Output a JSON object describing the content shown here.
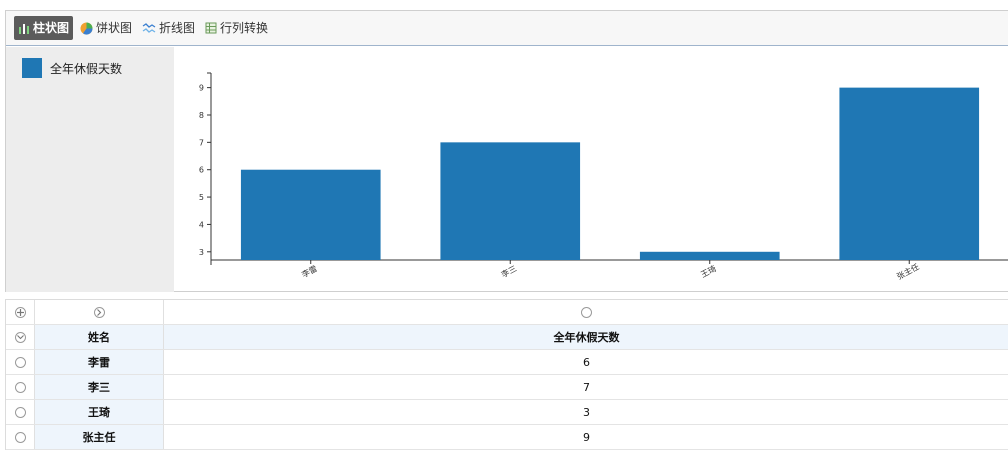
{
  "toolbar": {
    "buttons": [
      {
        "label": "柱状图",
        "icon": "bar-chart-icon",
        "active": true
      },
      {
        "label": "饼状图",
        "icon": "pie-chart-icon",
        "active": false
      },
      {
        "label": "折线图",
        "icon": "line-chart-icon",
        "active": false
      },
      {
        "label": "行列转换",
        "icon": "transpose-icon",
        "active": false
      }
    ]
  },
  "legend": {
    "label": "全年休假天数",
    "color": "#1f77b4"
  },
  "chart_data": {
    "type": "bar",
    "categories": [
      "李雷",
      "李三",
      "王琦",
      "张主任"
    ],
    "series": [
      {
        "name": "全年休假天数",
        "values": [
          6,
          7,
          3,
          9
        ],
        "color": "#1f77b4"
      }
    ],
    "ylim": [
      2.7,
      9.9
    ],
    "yticks": [
      3,
      4,
      5,
      6,
      7,
      8,
      9
    ],
    "xlabel": "",
    "ylabel": "",
    "title": "",
    "grid": false,
    "legend_position": "left"
  },
  "grid": {
    "columns": [
      "姓名",
      "全年休假天数"
    ],
    "rows": [
      {
        "name": "李雷",
        "value": "6"
      },
      {
        "name": "李三",
        "value": "7"
      },
      {
        "name": "王琦",
        "value": "3"
      },
      {
        "name": "张主任",
        "value": "9"
      }
    ]
  }
}
